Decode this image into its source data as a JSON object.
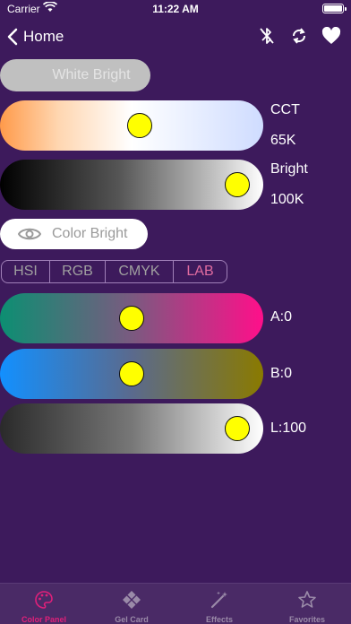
{
  "status_bar": {
    "carrier": "Carrier",
    "time": "11:22 AM"
  },
  "nav": {
    "back_label": "Home"
  },
  "white_bright": {
    "label": "White Bright"
  },
  "cct": {
    "label": "CCT",
    "value_text": "65K",
    "level": 0.53
  },
  "bright": {
    "label": "Bright",
    "value_text": "100K",
    "level": 0.9
  },
  "color_bright": {
    "label": "Color Bright"
  },
  "modes": [
    "HSI",
    "RGB",
    "CMYK",
    "LAB"
  ],
  "active_mode": "LAB",
  "lab": {
    "a": {
      "label": "A:0",
      "level": 0.5
    },
    "b": {
      "label": "B:0",
      "level": 0.5
    },
    "l": {
      "label": "L:100",
      "level": 0.9
    }
  },
  "tabs": [
    {
      "label": "Color Panel",
      "icon": "palette-icon",
      "active": true
    },
    {
      "label": "Gel Card",
      "icon": "diamond-grid-icon",
      "active": false
    },
    {
      "label": "Effects",
      "icon": "magic-wand-icon",
      "active": false
    },
    {
      "label": "Favorites",
      "icon": "star-icon",
      "active": false
    }
  ],
  "colors": {
    "background": "#3d1a5c",
    "accent": "#e0207a",
    "thumb": "#ffff00"
  }
}
